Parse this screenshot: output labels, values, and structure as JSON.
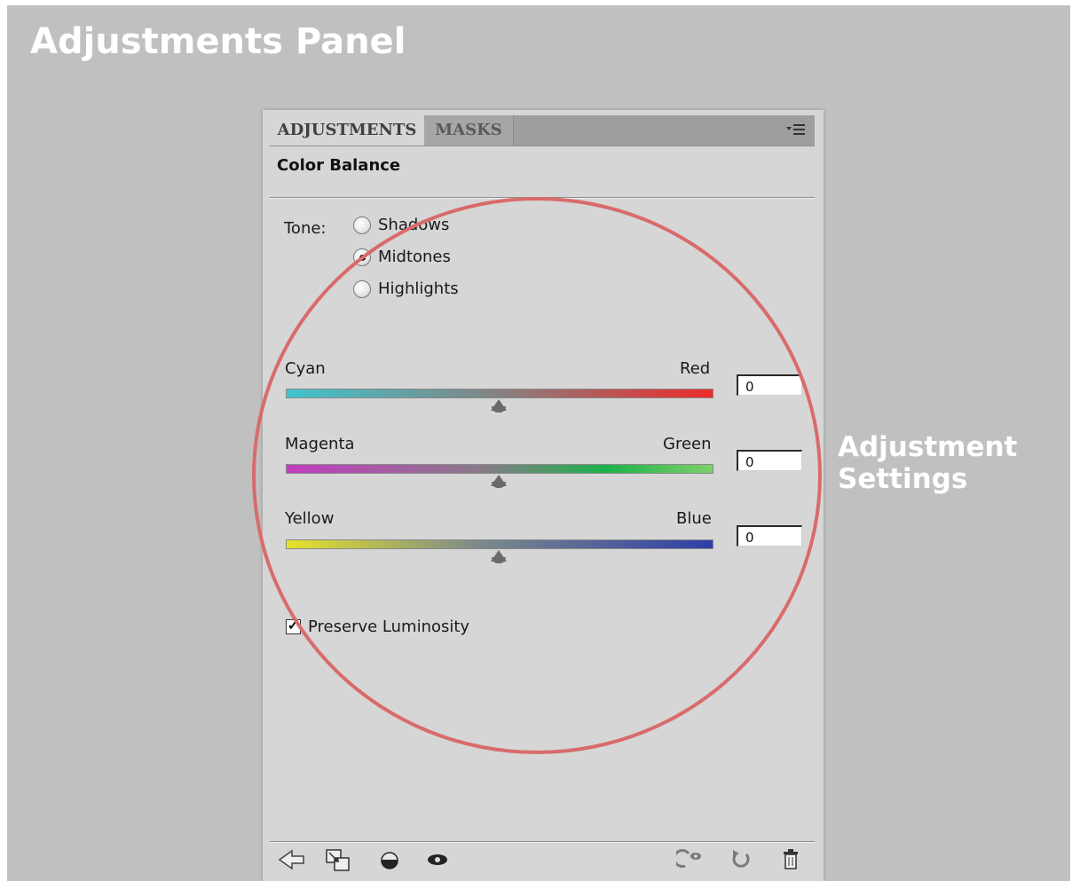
{
  "heading": "Adjustments Panel",
  "callout": {
    "line1": "Adjustment",
    "line2": "Settings"
  },
  "tabs": [
    {
      "label": "ADJUSTMENTS",
      "active": true
    },
    {
      "label": "MASKS",
      "active": false
    }
  ],
  "panel": {
    "title": "Color Balance",
    "tone": {
      "label": "Tone:",
      "options": [
        "Shadows",
        "Midtones",
        "Highlights"
      ],
      "selected": "Midtones"
    },
    "sliders": [
      {
        "left": "Cyan",
        "right": "Red",
        "value": "0",
        "left_color": "#3fc4cc",
        "right_color": "#ee2a2a",
        "position": 0.5
      },
      {
        "left": "Magenta",
        "right": "Green",
        "value": "0",
        "left_color": "#c23cc0",
        "right_color": "#7fd06a",
        "mid_color": "#1bb24a",
        "position": 0.5
      },
      {
        "left": "Yellow",
        "right": "Blue",
        "value": "0",
        "left_color": "#e6e22a",
        "right_color": "#2f3ea8",
        "position": 0.5
      }
    ],
    "preserve_luminosity": {
      "label": "Preserve Luminosity",
      "checked": true
    }
  },
  "footer_icons": [
    "back-arrow-icon",
    "clip-to-layer-icon",
    "visibility-toggle-icon",
    "view-previous-icon",
    "reset-icon",
    "delete-icon"
  ],
  "colors": {
    "circle": "#d96b6b",
    "background": "#c0c0c0",
    "panel": "#d6d6d6"
  }
}
